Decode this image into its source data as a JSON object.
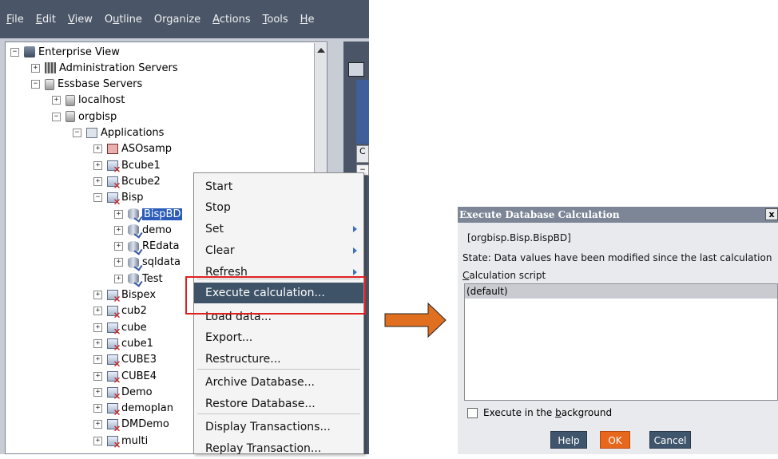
{
  "menubar": {
    "items": [
      {
        "label": "File",
        "ul": "F",
        "rest": "ile"
      },
      {
        "label": "Edit",
        "ul": "E",
        "rest": "dit"
      },
      {
        "label": "View",
        "ul": "V",
        "rest": "iew"
      },
      {
        "label": "Outline",
        "pre": "O",
        "ul": "u",
        "rest": "tline"
      },
      {
        "label": "Organize",
        "pre": "Or",
        "ul": "g",
        "rest": "anize"
      },
      {
        "label": "Actions",
        "ul": "A",
        "rest": "ctions"
      },
      {
        "label": "Tools",
        "ul": "T",
        "rest": "ools"
      },
      {
        "label": "Help",
        "ul": "H",
        "rest": "e"
      }
    ]
  },
  "tree": {
    "nodes": [
      {
        "label": "Enterprise View",
        "expander": "−",
        "icon": "computer-icon"
      },
      {
        "label": "Administration Servers",
        "expander": "+",
        "icon": "admin-server-icon"
      },
      {
        "label": "Essbase Servers",
        "expander": "−",
        "icon": "server-icon"
      },
      {
        "label": "localhost",
        "expander": "+",
        "icon": "server-icon"
      },
      {
        "label": "orgbisp",
        "expander": "−",
        "icon": "server-icon"
      },
      {
        "label": "Applications",
        "expander": "−",
        "icon": "applications-folder-icon"
      },
      {
        "label": "ASOsamp",
        "expander": "+",
        "icon": "aso-application-icon"
      },
      {
        "label": "Bcube1",
        "expander": "+",
        "icon": "application-icon"
      },
      {
        "label": "Bcube2",
        "expander": "+",
        "icon": "application-icon"
      },
      {
        "label": "Bisp",
        "expander": "−",
        "icon": "application-icon"
      },
      {
        "label": "BispBD",
        "expander": "+",
        "icon": "database-icon",
        "selected": true
      },
      {
        "label": "demo",
        "expander": "+",
        "icon": "database-icon"
      },
      {
        "label": "REdata",
        "expander": "+",
        "icon": "database-icon"
      },
      {
        "label": "sqldata",
        "expander": "+",
        "icon": "database-icon"
      },
      {
        "label": "Test",
        "expander": "+",
        "icon": "database-icon"
      },
      {
        "label": "Bispex",
        "expander": "+",
        "icon": "application-icon"
      },
      {
        "label": "cub2",
        "expander": "+",
        "icon": "application-icon"
      },
      {
        "label": "cube",
        "expander": "+",
        "icon": "application-icon"
      },
      {
        "label": "cube1",
        "expander": "+",
        "icon": "application-icon"
      },
      {
        "label": "CUBE3",
        "expander": "+",
        "icon": "application-icon"
      },
      {
        "label": "CUBE4",
        "expander": "+",
        "icon": "application-icon"
      },
      {
        "label": "Demo",
        "expander": "+",
        "icon": "application-icon"
      },
      {
        "label": "demoplan",
        "expander": "+",
        "icon": "application-icon"
      },
      {
        "label": "DMDemo",
        "expander": "+",
        "icon": "application-icon"
      },
      {
        "label": "multi",
        "expander": "+",
        "icon": "application-icon"
      }
    ]
  },
  "right_strip": {
    "tab_label": "C",
    "tab2_label": "−"
  },
  "context_menu": {
    "items": [
      {
        "label": "Start"
      },
      {
        "label": "Stop"
      },
      {
        "label": "Set",
        "submenu": true
      },
      {
        "label": "Clear",
        "submenu": true
      },
      {
        "label": "Refresh",
        "submenu": true
      },
      {
        "label": "Execute calculation...",
        "highlighted": true
      },
      {
        "label": "Load data..."
      },
      {
        "label": "Export..."
      },
      {
        "label": "Restructure..."
      },
      {
        "label": "Archive Database..."
      },
      {
        "label": "Restore Database..."
      },
      {
        "label": "Display Transactions..."
      },
      {
        "label": "Replay Transaction..."
      }
    ]
  },
  "arrow": {
    "color": "#e07020",
    "icon": "right-arrow-icon"
  },
  "dialog": {
    "title": "Execute Database Calculation",
    "close_label": "x",
    "path": "[orgbisp.Bisp.BispBD]",
    "state": "State: Data values have been modified since the last calculation",
    "script_label": "Calculation script",
    "script_selected": "(default)",
    "background_checkbox_label": "Execute in the background",
    "help_label": "Help",
    "ok_label": "OK",
    "cancel_label": "Cancel"
  },
  "colors": {
    "menubar_bg": "#4a5668",
    "menu_highlight": "#3e5268",
    "annotation_red": "#e02020",
    "ok_button": "#e7681c",
    "dialog_button": "#3f556c",
    "tree_selection": "#2b5cb8"
  }
}
